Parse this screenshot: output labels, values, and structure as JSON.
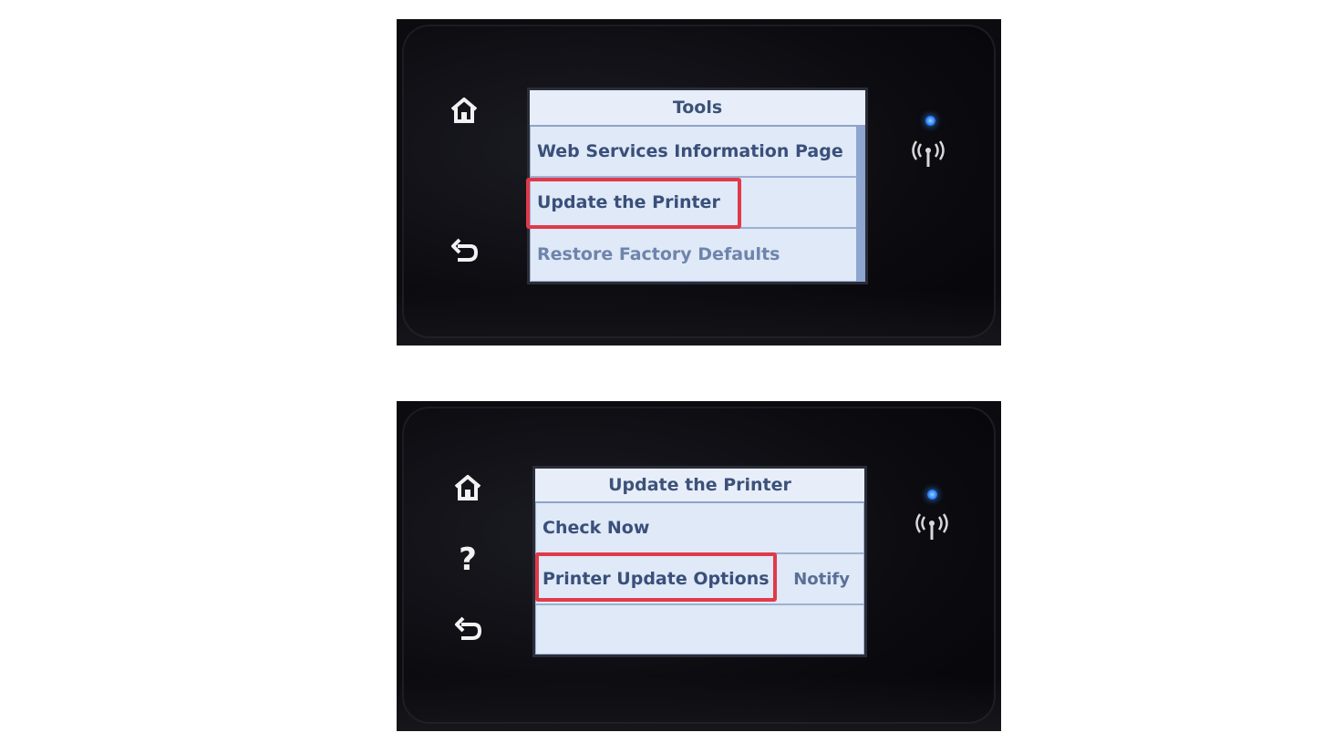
{
  "panel_top": {
    "screen_title": "Tools",
    "menu_items": [
      {
        "label": "Web Services Information Page"
      },
      {
        "label": "Update the Printer"
      },
      {
        "label": "Restore Factory Defaults"
      }
    ],
    "highlighted_item": "Update the Printer",
    "side_buttons": [
      "home-icon",
      "back-icon"
    ],
    "status_icons": [
      "wireless-led",
      "wireless-icon"
    ]
  },
  "panel_bottom": {
    "screen_title": "Update the Printer",
    "menu_items": [
      {
        "label": "Check Now",
        "value": ""
      },
      {
        "label": "Printer Update Options",
        "value": "Notify"
      }
    ],
    "highlighted_item": "Printer Update Options",
    "side_buttons": [
      "home-icon",
      "help-icon",
      "back-icon"
    ],
    "status_icons": [
      "wireless-led",
      "wireless-icon"
    ]
  },
  "colors": {
    "screen_bg": "#dfe9f7",
    "text": "#3a4f7a",
    "highlight": "#e03a4a",
    "led": "#2f86ff"
  }
}
